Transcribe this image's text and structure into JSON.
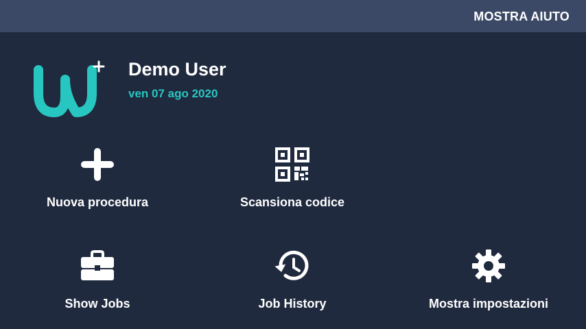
{
  "header": {
    "help_label": "MOSTRA AIUTO"
  },
  "profile": {
    "name": "Demo User",
    "date": "ven 07 ago 2020"
  },
  "colors": {
    "background": "#202a3f",
    "topbar": "#3b4966",
    "accent": "#28c6c0",
    "text": "#ffffff"
  },
  "menu": [
    {
      "label": "Nuova procedura",
      "icon": "plus-icon"
    },
    {
      "label": "Scansiona codice",
      "icon": "qr-code-icon"
    },
    {
      "label": "Show Jobs",
      "icon": "briefcase-icon"
    },
    {
      "label": "Job History",
      "icon": "history-icon"
    },
    {
      "label": "Mostra impostazioni",
      "icon": "gear-icon"
    }
  ]
}
